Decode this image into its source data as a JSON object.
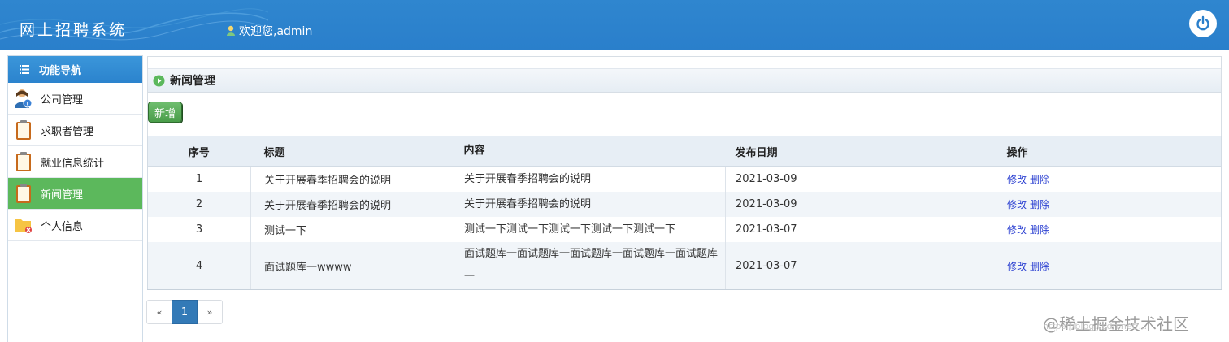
{
  "header": {
    "app_title": "网上招聘系统",
    "welcome_text": "欢迎您,admin",
    "colors": {
      "primary": "#2a7fcb",
      "accent_green": "#5cb85c"
    }
  },
  "sidebar": {
    "heading": "功能导航",
    "items": [
      {
        "label": "公司管理",
        "icon": "user-admin-icon",
        "active": false
      },
      {
        "label": "求职者管理",
        "icon": "clipboard-icon",
        "active": false
      },
      {
        "label": "就业信息统计",
        "icon": "clipboard-icon",
        "active": false
      },
      {
        "label": "新闻管理",
        "icon": "clipboard-icon",
        "active": true
      },
      {
        "label": "个人信息",
        "icon": "folder-icon",
        "active": false
      }
    ]
  },
  "main": {
    "panel_title": "新闻管理",
    "add_button": "新增",
    "table": {
      "columns": [
        "序号",
        "标题",
        "内容",
        "发布日期",
        "操作"
      ],
      "rows": [
        {
          "num": "1",
          "title": "关于开展春季招聘会的说明",
          "content": "关于开展春季招聘会的说明",
          "date": "2021-03-09",
          "edit": "修改",
          "delete": "删除"
        },
        {
          "num": "2",
          "title": "关于开展春季招聘会的说明",
          "content": "关于开展春季招聘会的说明",
          "date": "2021-03-09",
          "edit": "修改",
          "delete": "删除"
        },
        {
          "num": "3",
          "title": "测试一下",
          "content": "测试一下测试一下测试一下测试一下测试一下",
          "date": "2021-03-07",
          "edit": "修改",
          "delete": "删除"
        },
        {
          "num": "4",
          "title": "面试题库一wwww",
          "content": "面试题库一面试题库一面试题库一面试题库一面试题库一",
          "date": "2021-03-07",
          "edit": "修改",
          "delete": "删除"
        }
      ]
    },
    "pagination": {
      "prev": "«",
      "current": "1",
      "next": "»"
    }
  },
  "watermark": {
    "text": "@稀土掘金技术社区",
    "url": "https://blog.csdn.net/..."
  }
}
